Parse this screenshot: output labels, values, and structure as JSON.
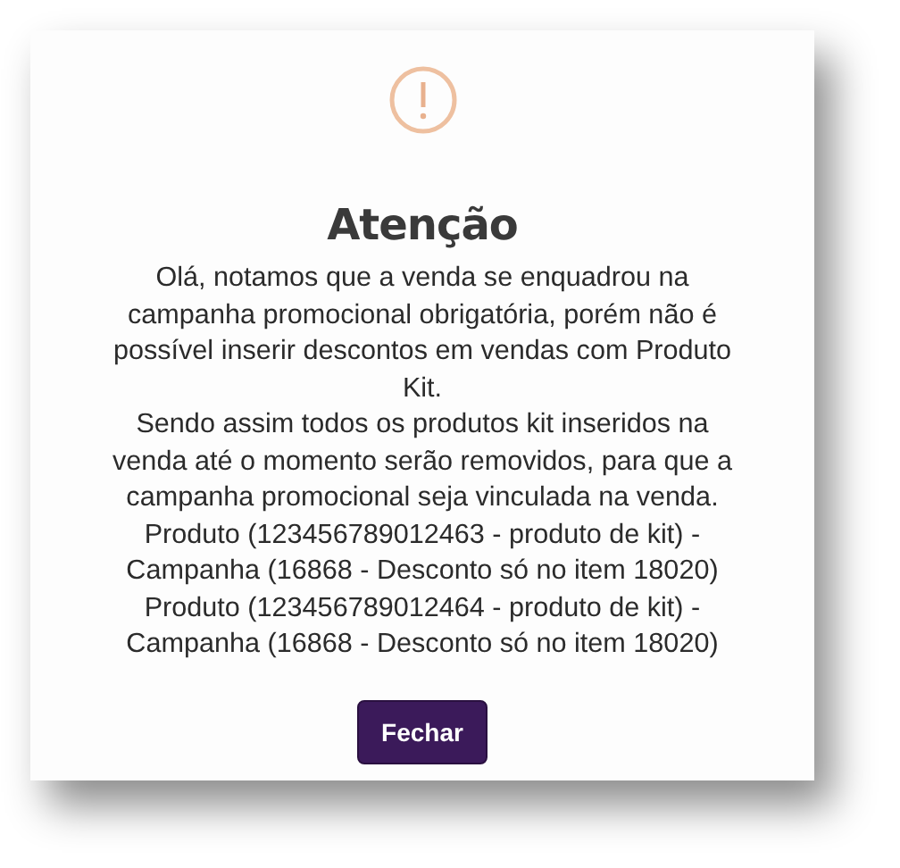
{
  "dialog": {
    "title": "Atenção",
    "message": [
      "Olá, notamos que a venda se enquadrou na campanha promocional obrigatória, porém não é possível inserir descontos em vendas com Produto Kit.",
      "Sendo assim todos os produtos kit inseridos na venda até o momento serão removidos, para que a campanha promocional seja vinculada na venda.",
      "Produto (123456789012463 - produto de kit) - Campanha (16868 - Desconto só no item 18020)",
      "Produto (123456789012464 - produto de kit) - Campanha (16868 - Desconto só no item 18020)"
    ],
    "buttons": [
      "Fechar"
    ]
  }
}
